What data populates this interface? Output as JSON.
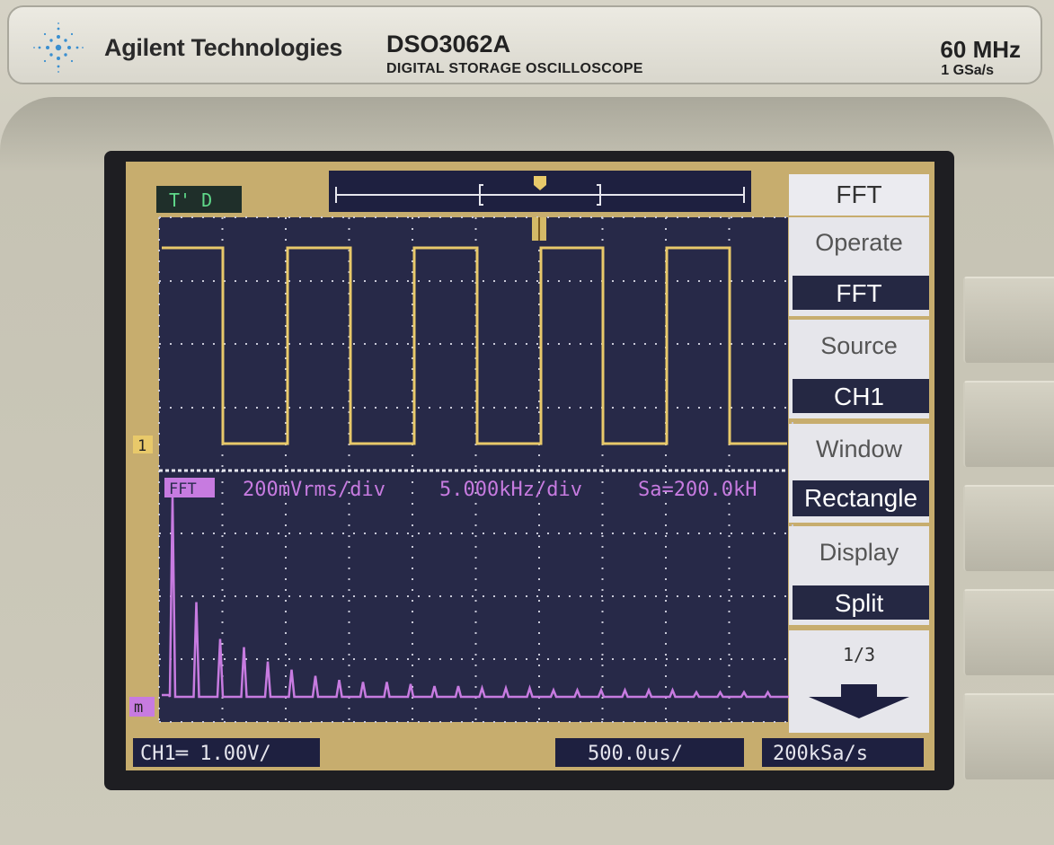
{
  "brand": {
    "company": "Agilent Technologies",
    "model": "DSO3062A",
    "model_subtitle": "DIGITAL STORAGE OSCILLOSCOPE",
    "bandwidth": "60 MHz",
    "sample_rate": "1 GSa/s"
  },
  "colors": {
    "trace_ch1": "#e8c96a",
    "trace_math": "#c77be0",
    "grid_bg": "#2a2b4d",
    "screen_bg": "#c7ad6e",
    "menu_bg": "#e9e9ee",
    "menu_selected_bg": "#252843"
  },
  "status": {
    "trigger_state": "T' D"
  },
  "channel_marker": "1",
  "math_marker": "m",
  "math_header": {
    "tag": "FFT",
    "scale": "200mVrms/div",
    "span": "5.000kHz/div",
    "sample": "Sa=200.0kH"
  },
  "footer": {
    "ch1": "CH1═ 1.00V/",
    "timebase": "500.0us/",
    "rate": "200kSa/s"
  },
  "menu": {
    "title": "FFT",
    "items": [
      {
        "label": "Operate",
        "value": "FFT"
      },
      {
        "label": "Source",
        "value": "CH1"
      },
      {
        "label": "Window",
        "value": "Rectangle"
      },
      {
        "label": "Display",
        "value": "Split"
      }
    ],
    "page": "1/3",
    "more_icon": "down-arrow-icon"
  },
  "spectrum_peaks": [
    1.0,
    0.48,
    0.3,
    0.26,
    0.19,
    0.15,
    0.12,
    0.1,
    0.09,
    0.09,
    0.08,
    0.07,
    0.07,
    0.06,
    0.06,
    0.06,
    0.05,
    0.05,
    0.05,
    0.05,
    0.05,
    0.05,
    0.04,
    0.04,
    0.04,
    0.04,
    0.04
  ]
}
